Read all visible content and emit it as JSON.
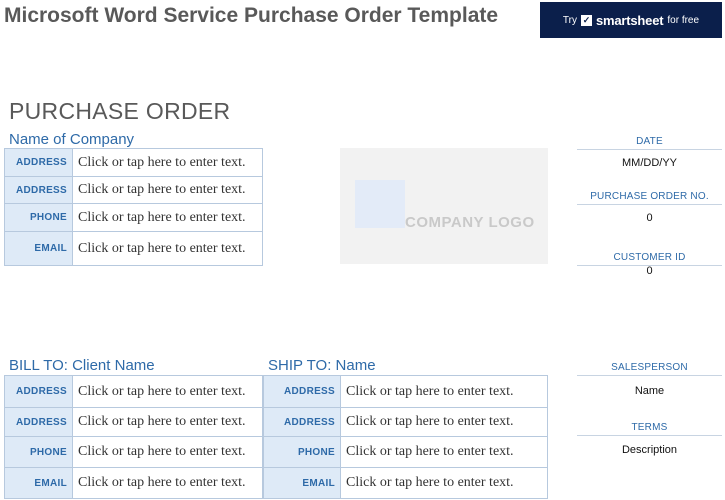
{
  "title": "Microsoft Word Service Purchase Order Template",
  "banner": {
    "try": "Try",
    "brand": "smartsheet",
    "suffix": "for free",
    "color": "#0b1f4b"
  },
  "heading": "PURCHASE ORDER",
  "company": {
    "name": "Name of Company",
    "rows": [
      {
        "label": "ADDRESS",
        "value": "Click or tap here to enter text."
      },
      {
        "label": "ADDRESS",
        "value": "Click or tap here to enter text."
      },
      {
        "label": "PHONE",
        "value": "Click or tap here to enter text."
      },
      {
        "label": "EMAIL",
        "value": "Click or tap here to enter text."
      }
    ]
  },
  "logo": {
    "text": "COMPANY LOGO"
  },
  "side": {
    "date_label": "DATE",
    "date_value": "MM/DD/YY",
    "po_label": "PURCHASE ORDER NO.",
    "po_value": "0",
    "customer_label": "CUSTOMER ID",
    "customer_value": "0",
    "salesperson_label": "SALESPERSON",
    "salesperson_value": "Name",
    "terms_label": "TERMS",
    "terms_value": "Description"
  },
  "bill_to": {
    "title": "BILL TO: Client Name",
    "rows": [
      {
        "label": "ADDRESS",
        "value": "Click or tap here to enter text."
      },
      {
        "label": "ADDRESS",
        "value": "Click or tap here to enter text."
      },
      {
        "label": "PHONE",
        "value": "Click or tap here to enter text."
      },
      {
        "label": "EMAIL",
        "value": "Click or tap here to enter text."
      }
    ]
  },
  "ship_to": {
    "title": "SHIP TO: Name",
    "rows": [
      {
        "label": "ADDRESS",
        "value": "Click or tap here to enter text."
      },
      {
        "label": "ADDRESS",
        "value": "Click or tap here to enter text."
      },
      {
        "label": "PHONE",
        "value": "Click or tap here to enter text."
      },
      {
        "label": "EMAIL",
        "value": "Click or tap here to enter text."
      }
    ]
  }
}
